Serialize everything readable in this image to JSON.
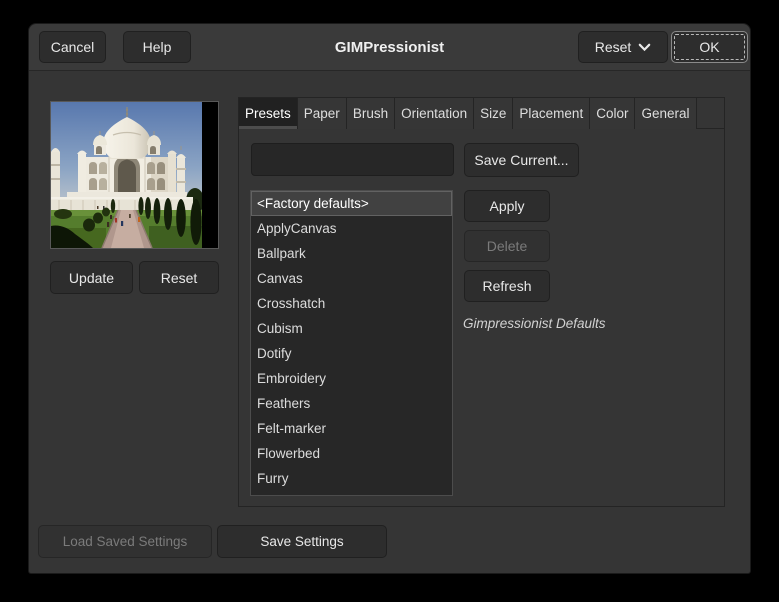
{
  "window": {
    "title": "GIMPressionist"
  },
  "header": {
    "cancel_label": "Cancel",
    "help_label": "Help",
    "reset_label": "Reset",
    "ok_label": "OK"
  },
  "preview": {
    "update_label": "Update",
    "reset_label": "Reset",
    "image_description": "Taj Mahal photo preview"
  },
  "tabs": {
    "active_tab": "Presets",
    "labels": [
      "Presets",
      "Paper",
      "Brush",
      "Orientation",
      "Size",
      "Placement",
      "Color",
      "General"
    ]
  },
  "presets": {
    "name_value": "",
    "save_current_label": "Save Current...",
    "apply_label": "Apply",
    "delete_label": "Delete",
    "refresh_label": "Refresh",
    "description": "Gimpressionist Defaults",
    "selected_item": "<Factory defaults>",
    "items": [
      "<Factory defaults>",
      "ApplyCanvas",
      "Ballpark",
      "Canvas",
      "Crosshatch",
      "Cubism",
      "Dotify",
      "Embroidery",
      "Feathers",
      "Felt-marker",
      "Flowerbed",
      "Furry"
    ]
  },
  "footer": {
    "load_label": "Load Saved Settings",
    "save_label": "Save Settings"
  },
  "icons": {
    "reset_dropdown": "chevron-down-icon"
  },
  "colors": {
    "window_outer": "#000000",
    "dialog_bg": "#353535",
    "header_bg": "#3a3a3a",
    "button_bg": "#2d2d2d",
    "list_bg": "#272727",
    "selected_row_bg": "#414141",
    "active_tab_bg": "#212121",
    "text": "#e6e6e6",
    "disabled_text": "#7b7b7b"
  }
}
